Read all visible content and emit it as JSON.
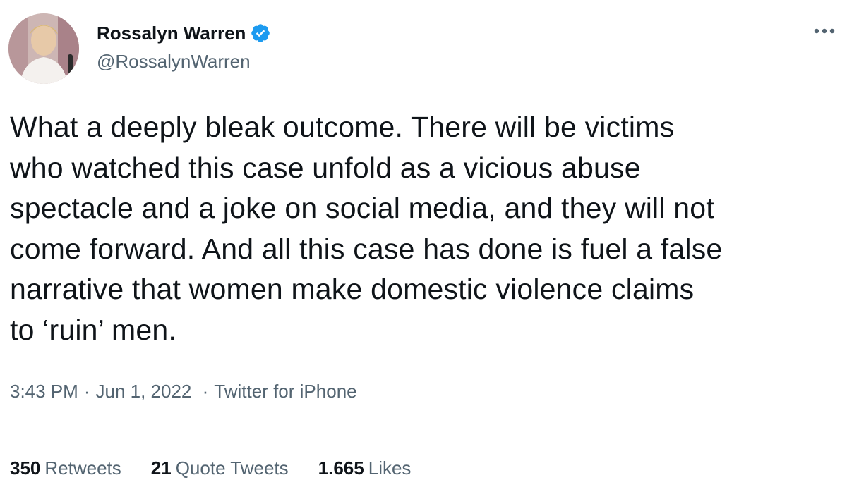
{
  "author": {
    "display_name": "Rossalyn Warren",
    "handle": "@RossalynWarren",
    "verified_color": "#1d9bf0"
  },
  "tweet": {
    "lines": [
      "What a deeply bleak outcome. There will be victims",
      "who watched this case unfold as a vicious abuse",
      "spectacle and a joke on social media, and they will not",
      "come forward. And all this case has done is fuel a false",
      "narrative that women make domestic violence claims",
      "to ‘ruin’ men."
    ],
    "time": "3:43 PM",
    "date": "Jun 1, 2022",
    "source": "Twitter for iPhone",
    "separator": "·"
  },
  "stats": {
    "retweets_count": "350",
    "retweets_label": "Retweets",
    "quotes_count": "21",
    "quotes_label": "Quote Tweets",
    "likes_count": "1.665",
    "likes_label": "Likes"
  },
  "icons": {
    "verified": "verified-badge-icon",
    "more": "more-options-icon"
  }
}
